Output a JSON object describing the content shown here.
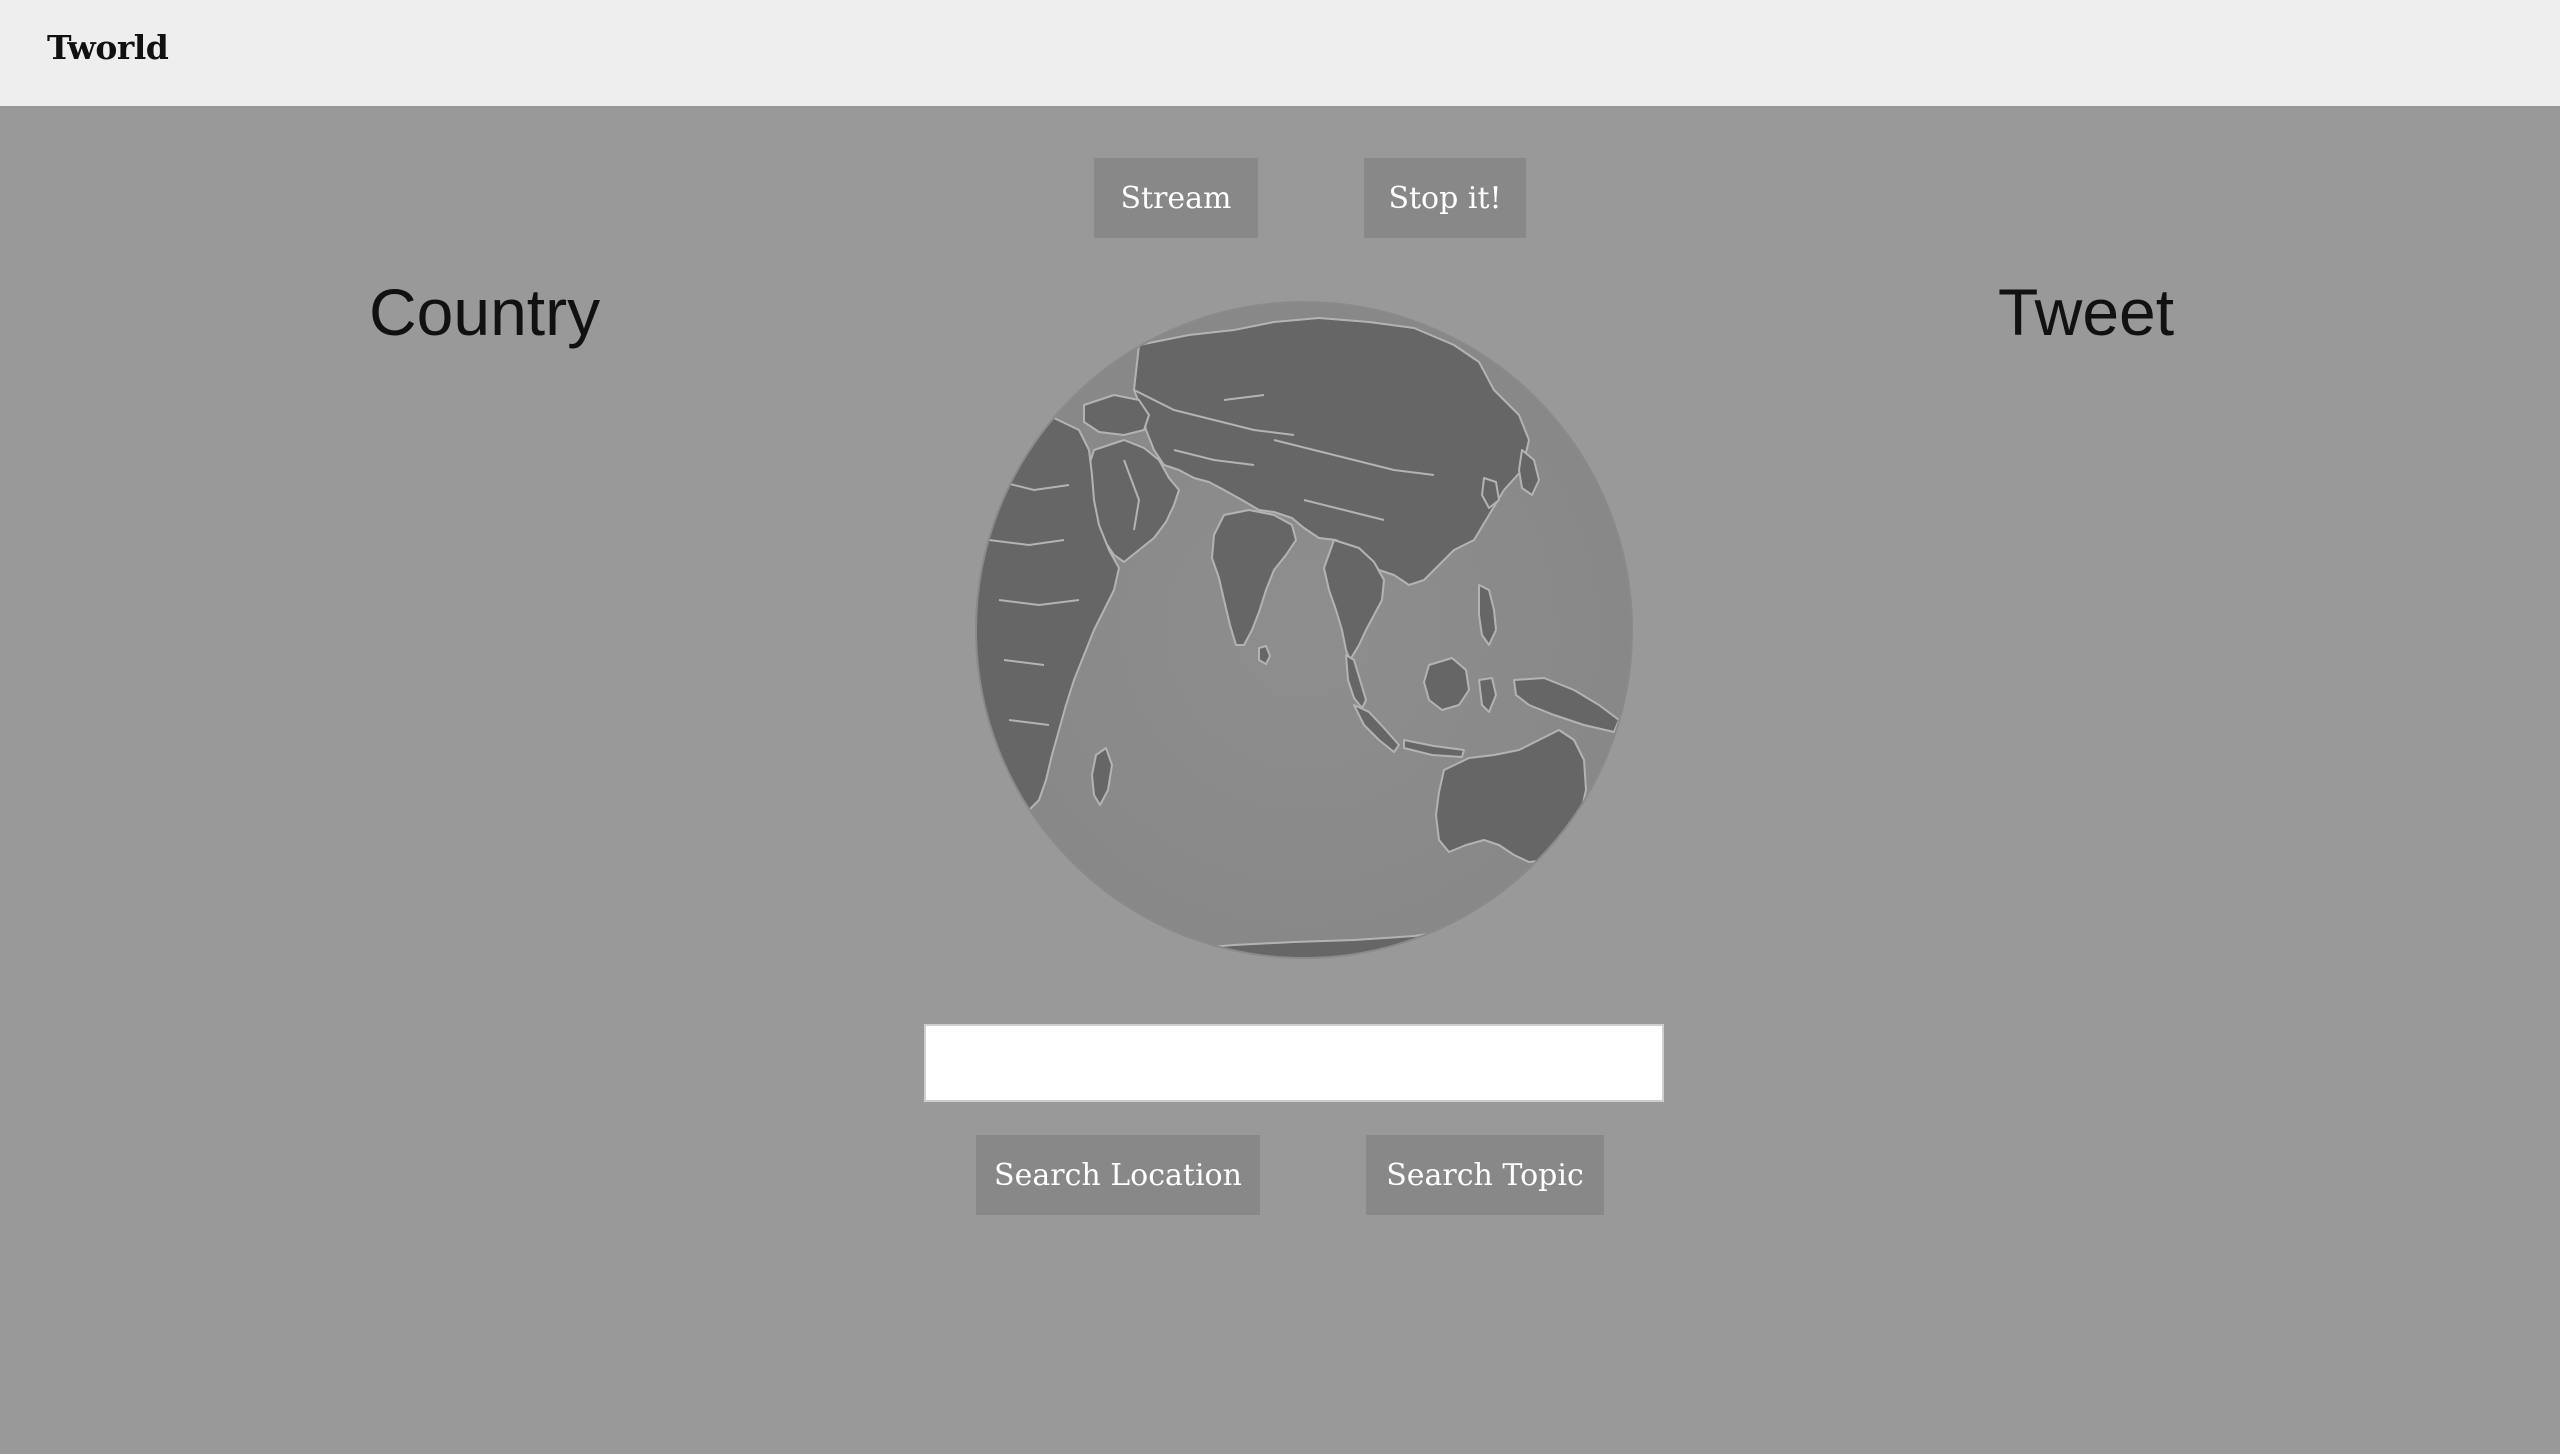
{
  "navbar": {
    "brand": "Tworld"
  },
  "controls": {
    "stream_label": "Stream",
    "stop_label": "Stop it!"
  },
  "columns": {
    "left_heading": "Country",
    "right_heading": "Tweet"
  },
  "search": {
    "value": "",
    "placeholder": "",
    "location_label": "Search Location",
    "topic_label": "Search Topic"
  },
  "globe": {
    "icon": "globe-map",
    "ocean_color": "#8c8c8c",
    "land_color": "#666666",
    "border_color": "#b3b3b3"
  },
  "colors": {
    "background": "#999999",
    "navbar": "#eeeeee",
    "button": "#888888",
    "button_text": "#ffffff"
  }
}
